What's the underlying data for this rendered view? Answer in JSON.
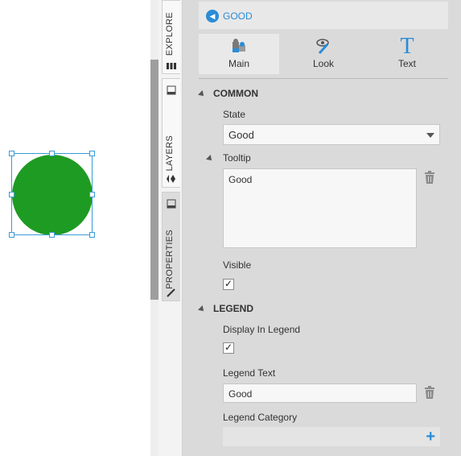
{
  "header": {
    "back_label": "GOOD"
  },
  "vertical_tabs": [
    {
      "label": "EXPLORE"
    },
    {
      "label": "LAYERS"
    },
    {
      "label": "PROPERTIES"
    }
  ],
  "subtabs": [
    {
      "label": "Main"
    },
    {
      "label": "Look"
    },
    {
      "label": "Text"
    }
  ],
  "common": {
    "title": "COMMON",
    "state_label": "State",
    "state_value": "Good",
    "tooltip_label": "Tooltip",
    "tooltip_value": "Good",
    "visible_label": "Visible"
  },
  "legend": {
    "title": "LEGEND",
    "display_label": "Display In Legend",
    "text_label": "Legend Text",
    "text_value": "Good",
    "category_label": "Legend Category"
  },
  "colors": {
    "accent": "#2a8cd7",
    "shape_fill": "#1e9b22",
    "selection": "#3a9bd6"
  }
}
